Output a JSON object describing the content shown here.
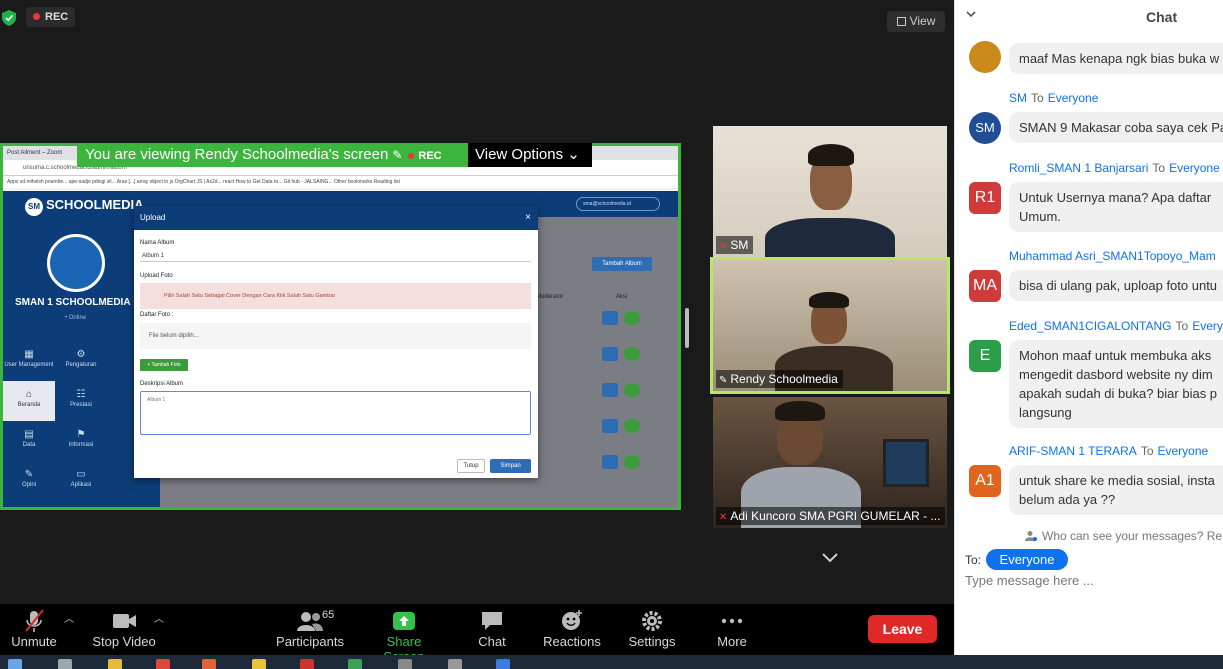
{
  "meeting": {
    "rec_label": "REC",
    "view_label": "View",
    "viewing_banner": "You are viewing Rendy Schoolmedia's screen",
    "banner_rec": "REC",
    "view_options": "View Options"
  },
  "shared_screen": {
    "browser_tab": "Post Ailment – Zoom",
    "address": "unsuma.c.schoolmedia.id/admin/album",
    "bookmarks": "Apps   sd.mihelsh poumbe...   ape-sadjo pdingi sil...   Aras [...]   array object in js   OrgChart JS | Ax2d...   react   How to Get Data to...   Git hub - JALSAING...        Other bookmarks   Reading list",
    "app_brand": "SCHOOLMEDIA",
    "app_sm": "SM",
    "school_name": "SMAN 1 SCHOOLMEDIA",
    "online": "• Online",
    "header_email": "sma@schoolmedia.id",
    "tambah_album": "Tambah Album",
    "col_moderator": "Moderator",
    "col_aksi": "Aksi",
    "nav": [
      {
        "label": "User Management",
        "icon": "▦"
      },
      {
        "label": "Pengaturan",
        "icon": "⚙"
      },
      {
        "label": "Beranda",
        "icon": "⌂"
      },
      {
        "label": "Prestasi",
        "icon": "☷"
      },
      {
        "label": "Data",
        "icon": "▤"
      },
      {
        "label": "Informasi",
        "icon": "⚑"
      },
      {
        "label": "Opini",
        "icon": "✎"
      },
      {
        "label": "Aplikasi",
        "icon": "▭"
      }
    ],
    "modal": {
      "title": "Upload",
      "close": "×",
      "nama_album_label": "Nama Album",
      "nama_album_value": "Album 1",
      "upload_foto_label": "Upload Foto",
      "alert_text": "Pilih Salah Satu Sebagai Cover Dengan Cara Klik Salah Satu Gambar",
      "daftar_foto_label": "Daftar Foto :",
      "file_text": "File belum dipilih...",
      "tambah_foto": "+ Tambah Foto",
      "deskripsi_label": "Deskripsi Album",
      "deskripsi_value": "Album 1",
      "tutup": "Tutup",
      "simpan": "Simpan"
    }
  },
  "participants": [
    {
      "name": "SM"
    },
    {
      "name": "Rendy Schoolmedia"
    },
    {
      "name": "Adi Kuncoro SMA PGRI GUMELAR - ..."
    }
  ],
  "toolbar": {
    "unmute": "Unmute",
    "stop_video": "Stop Video",
    "participants": "Participants",
    "participants_count": "65",
    "share_screen": "Share Screen",
    "chat": "Chat",
    "reactions": "Reactions",
    "settings": "Settings",
    "more": "More",
    "leave": "Leave"
  },
  "chat": {
    "title": "Chat",
    "to_word": "To",
    "messages": [
      {
        "sender": "",
        "recipient": "",
        "avatar": "",
        "avatar_color": "#c98a1b",
        "text": "maaf Mas kenapa ngk bias buka w"
      },
      {
        "sender": "SM",
        "recipient": "Everyone",
        "avatar": "SM",
        "avatar_color": "#1f4e96",
        "text": "SMAN 9 Makasar coba saya cek Pa"
      },
      {
        "sender": "Romli_SMAN 1 Banjarsari",
        "recipient": "Everyone",
        "avatar": "R1",
        "avatar_color": "#cf3a3a",
        "text": "Untuk Usernya mana? Apa daftar\nUmum."
      },
      {
        "sender": "Muhammad Asri_SMAN1Topoyo_Mam",
        "recipient": "",
        "avatar": "MA",
        "avatar_color": "#cf3a3a",
        "text": "bisa di ulang pak, uploap foto untu"
      },
      {
        "sender": "Eded_SMAN1CIGALONTANG",
        "recipient": "Every",
        "avatar": "E",
        "avatar_color": "#2c9e4b",
        "text": "Mohon maaf untuk membuka aks\nmengedit dasbord website ny dim\napakah sudah di buka? biar bias p\nlangsung"
      },
      {
        "sender": "ARIF-SMAN 1 TERARA",
        "recipient": "Everyone",
        "avatar": "A1",
        "avatar_color": "#e0631e",
        "text": "untuk share ke media sosial, insta\nbelum ada ya ??"
      }
    ],
    "who_can_see": "Who can see your messages? Re",
    "to_label": "To:",
    "to_target": "Everyone",
    "input_placeholder": "Type message here ..."
  },
  "colors": {
    "share_green": "#3bb53b",
    "leave_red": "#e02828",
    "zoom_blue": "#0e72ed",
    "active_speaker": "#b9e66a"
  }
}
